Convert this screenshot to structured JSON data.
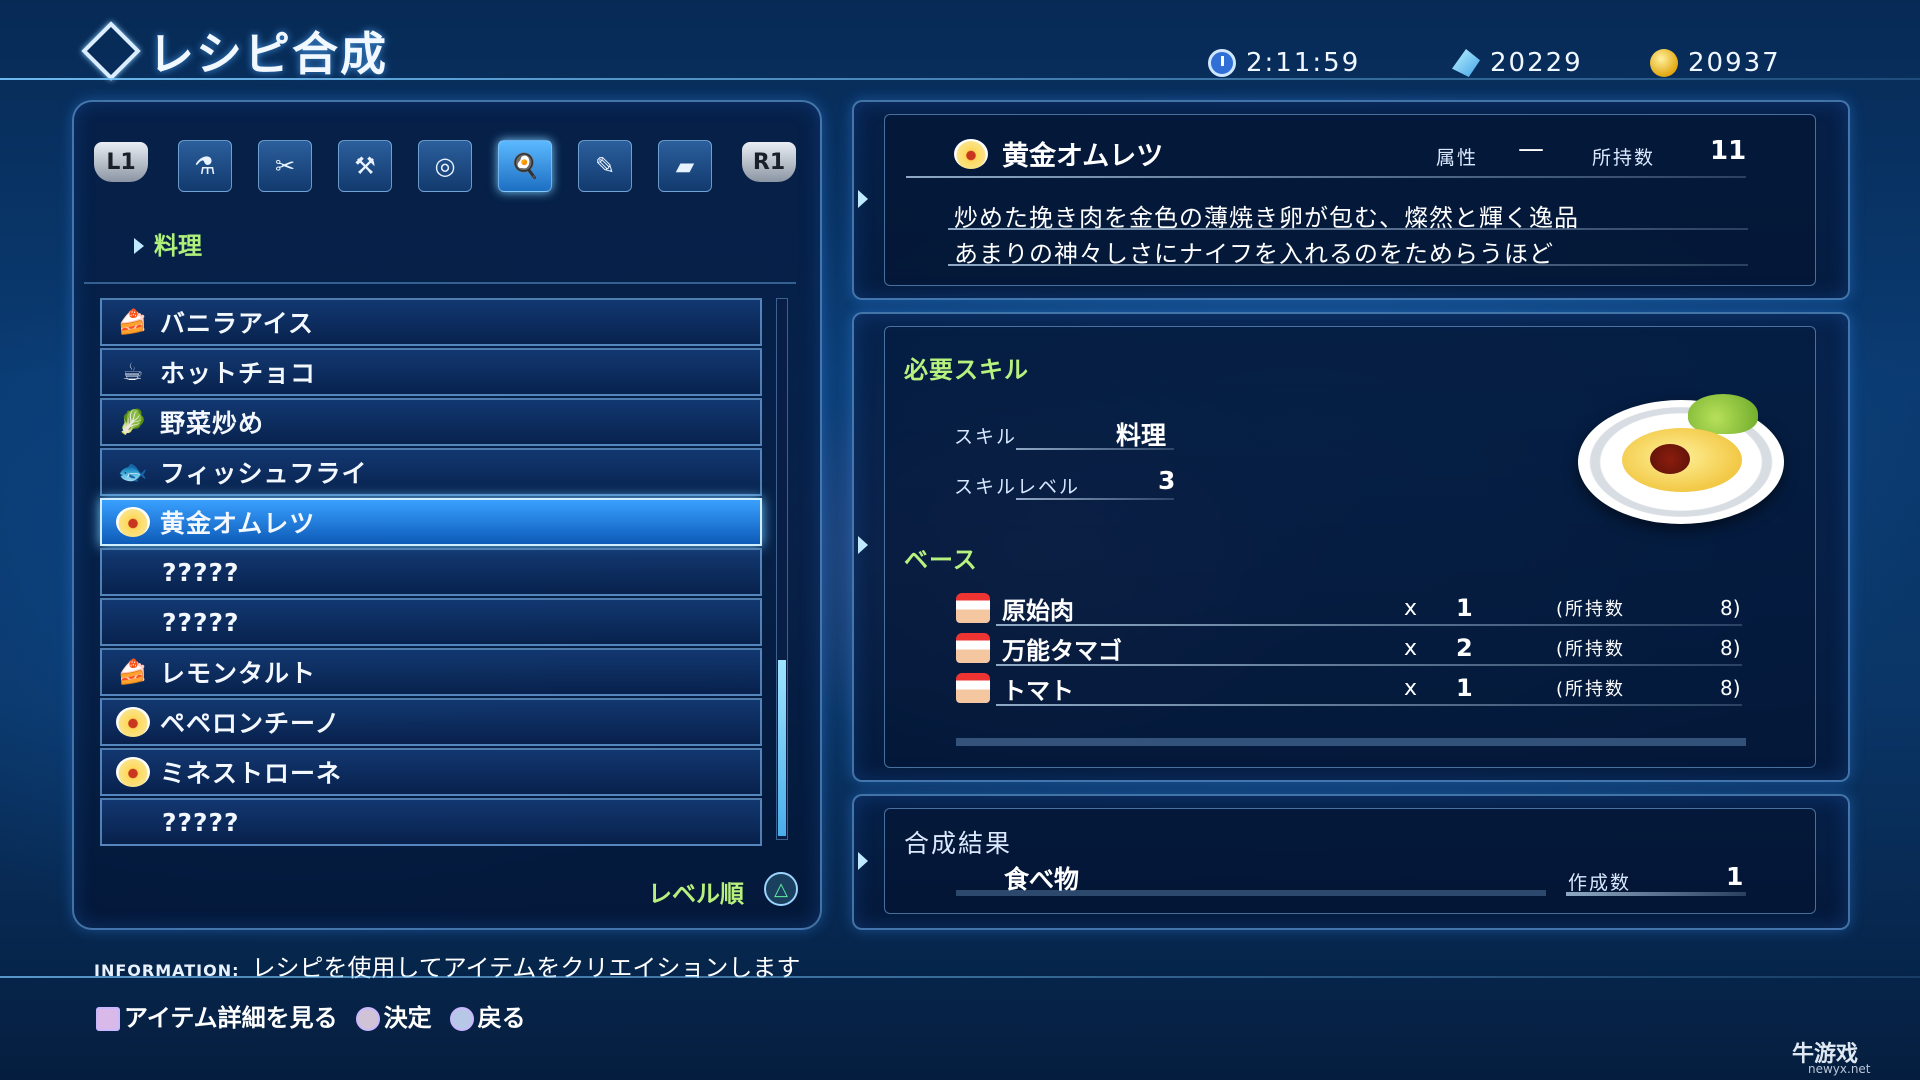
{
  "header": {
    "title": "レシピ合成",
    "time": "2:11:59",
    "fol": "20229",
    "gold": "20937"
  },
  "tabs": {
    "left_button": "L1",
    "right_button": "R1",
    "icons": [
      "potion-icon",
      "tools-icon",
      "hammer-icon",
      "ring-icon",
      "cooking-icon",
      "writing-icon",
      "ingot-icon"
    ],
    "active_index": 4
  },
  "category": "料理",
  "recipe_list": [
    {
      "name": "バニラアイス",
      "icon": "cake-icon"
    },
    {
      "name": "ホットチョコ",
      "icon": "cup-icon"
    },
    {
      "name": "野菜炒め",
      "icon": "vegetable-icon"
    },
    {
      "name": "フィッシュフライ",
      "icon": "fish-icon"
    },
    {
      "name": "黄金オムレツ",
      "icon": "omelet-icon",
      "selected": true
    },
    {
      "name": "?????",
      "icon": ""
    },
    {
      "name": "?????",
      "icon": ""
    },
    {
      "name": "レモンタルト",
      "icon": "cake-icon"
    },
    {
      "name": "ペペロンチーノ",
      "icon": "omelet-icon"
    },
    {
      "name": "ミネストローネ",
      "icon": "omelet-icon"
    },
    {
      "name": "?????",
      "icon": ""
    }
  ],
  "sort_label": "レベル順",
  "detail": {
    "name": "黄金オムレツ",
    "attribute_label": "属性",
    "attribute_value": "—",
    "owned_label": "所持数",
    "owned_value": "11",
    "desc_line1": "炒めた挽き肉を金色の薄焼き卵が包む、燦然と輝く逸品",
    "desc_line2": "あまりの神々しさにナイフを入れるのをためらうほど"
  },
  "requirements": {
    "skill_title": "必要スキル",
    "skill_label": "スキル",
    "skill_value": "料理",
    "level_label": "スキルレベル",
    "level_value": "3",
    "base_title": "ベース",
    "materials": [
      {
        "name": "原始肉",
        "x": "x",
        "qty": "1",
        "owned_label": "(所持数",
        "owned": "8)"
      },
      {
        "name": "万能タマゴ",
        "x": "x",
        "qty": "2",
        "owned_label": "(所持数",
        "owned": "8)"
      },
      {
        "name": "トマト",
        "x": "x",
        "qty": "1",
        "owned_label": "(所持数",
        "owned": "8)"
      }
    ]
  },
  "result": {
    "title": "合成結果",
    "item": "食べ物",
    "count_label": "作成数",
    "count_value": "1"
  },
  "info": {
    "tag": "INFORMATION:",
    "text": "レシピを使用してアイテムをクリエイションします"
  },
  "controls": {
    "square": "アイテム詳細を見る",
    "circle": "決定",
    "cross": "戻る"
  },
  "watermark": {
    "main": "牛游戏",
    "sub": "newyx.net"
  }
}
